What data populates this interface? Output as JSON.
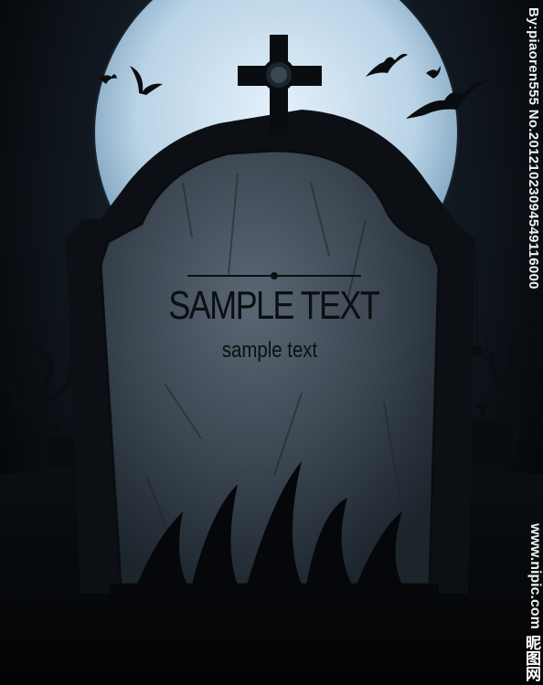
{
  "tombstone": {
    "title": "SAMPLE TEXT",
    "subtitle": "sample text"
  },
  "watermark": {
    "credit": "By:piaoren555 No.20121023094549116000",
    "site": "www.nipic.com",
    "brand": "昵图网"
  },
  "colors": {
    "moon": "#cfe3f2",
    "sky_dark": "#05080b",
    "stone_face": "#4a5663",
    "stone_frame": "#0c1014",
    "text": "#0c0f12"
  },
  "icons": [
    "bat-icon",
    "cross-icon",
    "spider-icon",
    "moon-icon",
    "tree-icon",
    "grave-icon"
  ]
}
